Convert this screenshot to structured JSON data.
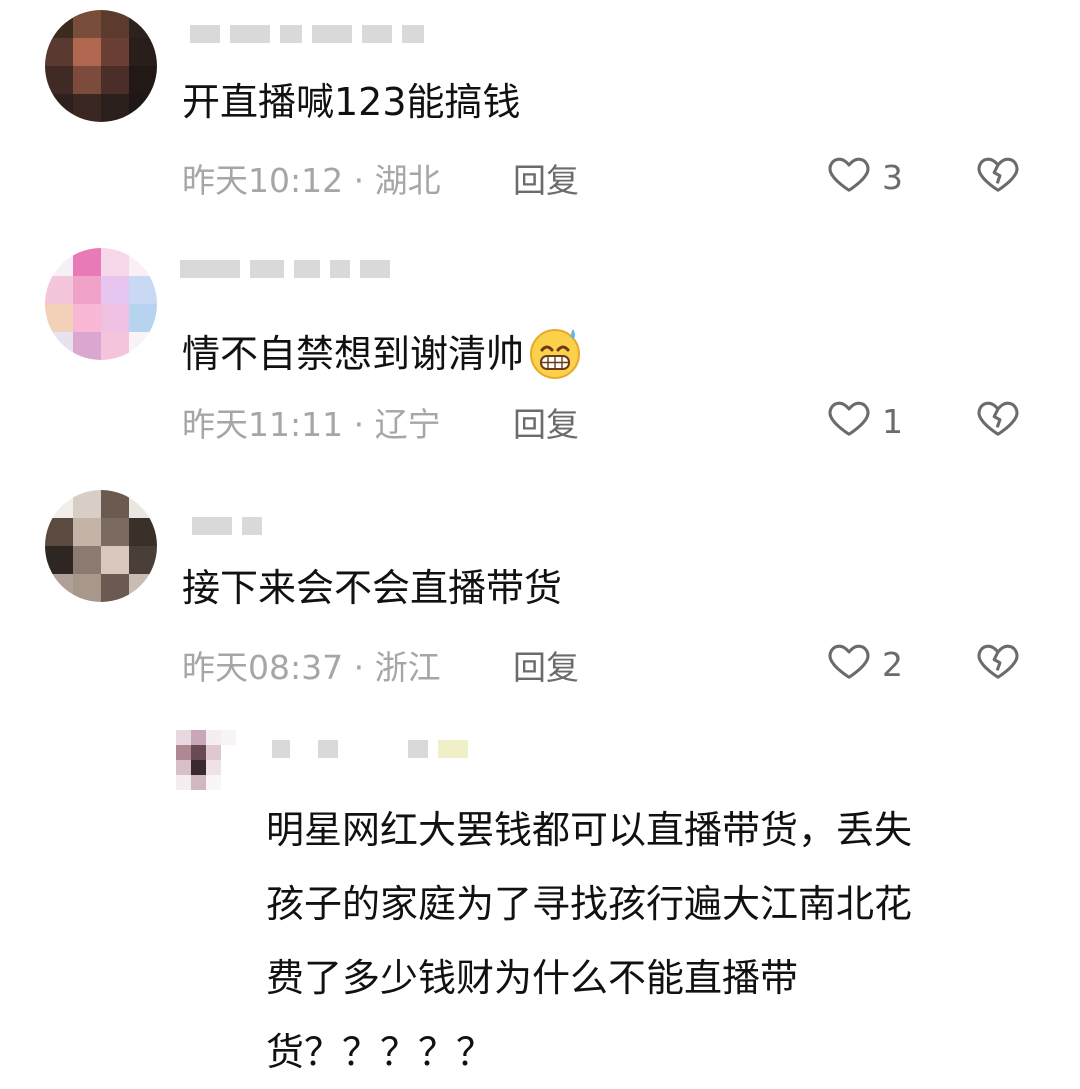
{
  "comments": [
    {
      "text": "开直播喊123能搞钱",
      "time": "昨天10:12",
      "location": "湖北",
      "reply_label": "回复",
      "likes": "3",
      "avatar_colors": [
        "#3a2a20",
        "#7a4c3a",
        "#5d3a2e",
        "#2c2220",
        "#5a3a30",
        "#b0674f",
        "#6c3f34",
        "#2a1e1c",
        "#3f2a25",
        "#7c4b3b",
        "#4a2e27",
        "#221816",
        "#2e201c",
        "#3b2722",
        "#2b1f1b",
        "#1f1715"
      ]
    },
    {
      "text": "情不自禁想到谢清帅",
      "time": "昨天11:11",
      "location": "辽宁",
      "reply_label": "回复",
      "likes": "1",
      "avatar_colors": [
        "#f6f0f6",
        "#e87ab8",
        "#f6d8ea",
        "#fbeef4",
        "#f4c6dc",
        "#f1a2c8",
        "#e6c5f0",
        "#c9d9f4",
        "#f2d1b8",
        "#f8b8d6",
        "#f0c0e2",
        "#b6d4f0",
        "#e8e2ee",
        "#dba6cf",
        "#f4c4dc",
        "#f9f3f8"
      ]
    },
    {
      "text": "接下来会不会直播带货",
      "time": "昨天08:37",
      "location": "浙江",
      "reply_label": "回复",
      "likes": "2",
      "avatar_colors": [
        "#f2eeea",
        "#d8cec6",
        "#6b5a50",
        "#eae6e2",
        "#5a4a40",
        "#c4b4a8",
        "#7a6a60",
        "#3a302a",
        "#2e2622",
        "#8a7a70",
        "#d8c8bc",
        "#4a3e38",
        "#b0a098",
        "#a8988c",
        "#6a5a52",
        "#c8bcb4"
      ]
    }
  ],
  "reply": {
    "paragraph_lines": [
      "明星网红大罢钱都可以直播带货，丢失",
      "孩子的家庭为了寻找孩行遍大江南北花",
      "费了多少钱财为什么不能直播带",
      "货？？？？？"
    ],
    "avatar_colors": [
      "#e8d8e0",
      "#c8a8b8",
      "#f4eef2",
      "#f8f4f6",
      "#b08894",
      "#6a4a52",
      "#e0c8d0",
      "#ffffff",
      "#d8c0c8",
      "#3a2a30",
      "#f0e0e8",
      "#ffffff",
      "#f4eef0",
      "#d0b8c0",
      "#faf6f8",
      "#ffffff"
    ]
  },
  "separator": " · "
}
